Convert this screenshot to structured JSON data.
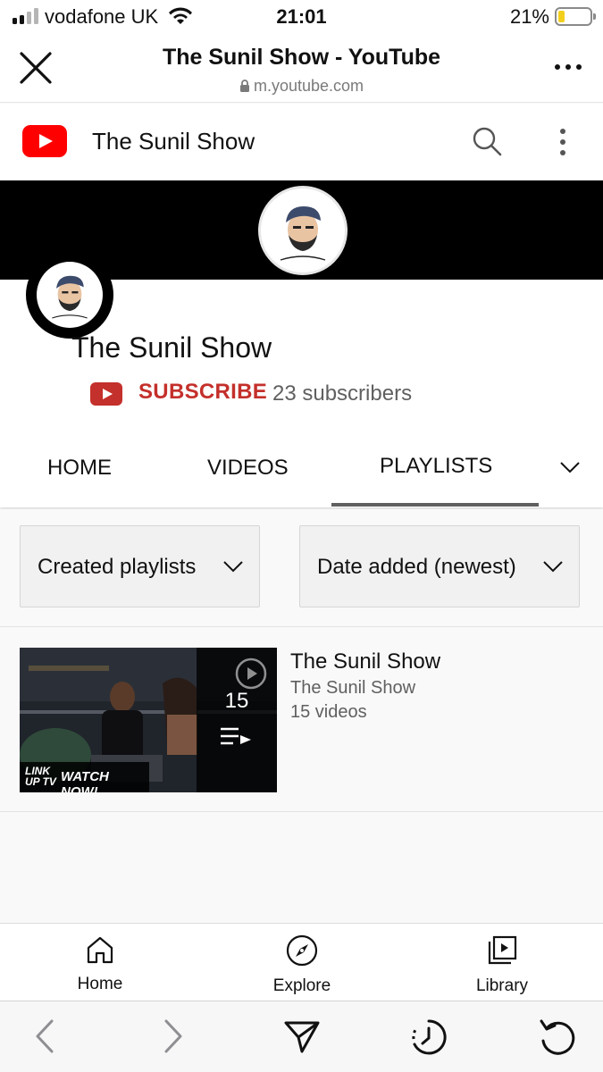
{
  "status_bar": {
    "carrier": "vodafone UK",
    "time": "21:01",
    "battery_percent": "21%",
    "battery_level": 0.21,
    "battery_color": "#f3cf1d"
  },
  "browser": {
    "page_title": "The Sunil Show - YouTube",
    "url": "m.youtube.com"
  },
  "yt_header": {
    "title": "The Sunil Show",
    "brand_color": "#ff0000"
  },
  "channel": {
    "name": "The Sunil Show",
    "subscribe_label": "SUBSCRIBE",
    "subscribers": "23 subscribers",
    "subscribe_color": "#c4302b"
  },
  "tabs": {
    "home": "HOME",
    "videos": "VIDEOS",
    "playlists": "PLAYLISTS",
    "active": "PLAYLISTS"
  },
  "filters": {
    "type": "Created playlists",
    "sort": "Date added (newest)"
  },
  "playlists": [
    {
      "title": "The Sunil Show",
      "channel": "The Sunil Show",
      "video_count_label": "15 videos",
      "count": "15",
      "thumb_banner_text": "WATCH NOW!",
      "thumb_logo_text": "LINK UP TV"
    }
  ],
  "bottom_nav": {
    "home": "Home",
    "explore": "Explore",
    "library": "Library"
  }
}
